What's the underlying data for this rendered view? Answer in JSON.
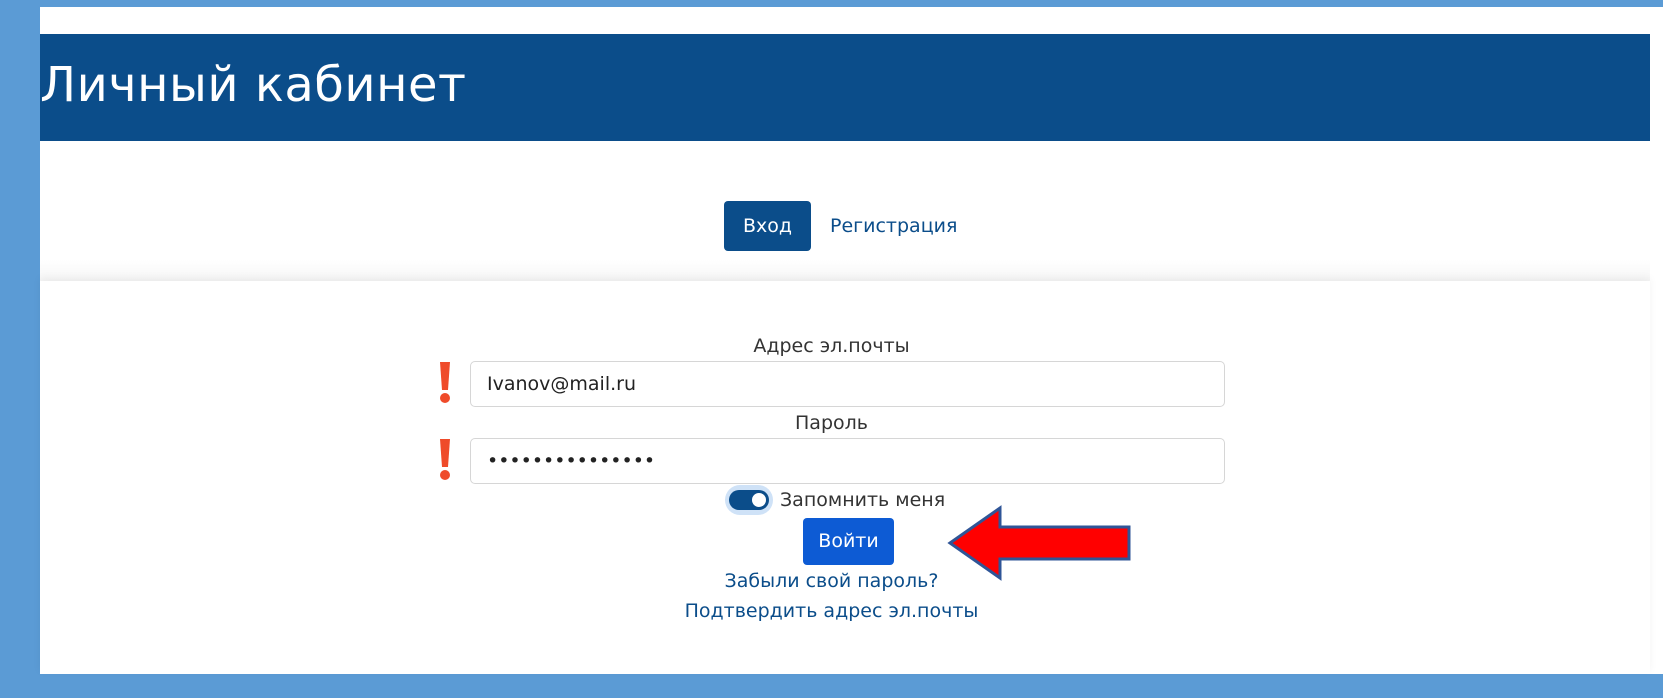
{
  "header": {
    "title": "Личный кабинет"
  },
  "tabs": [
    {
      "label": "Вход",
      "active": true
    },
    {
      "label": "Регистрация",
      "active": false
    }
  ],
  "form": {
    "email_label": "Адрес эл.почты",
    "email_value": "Ivanov@mail.ru",
    "password_label": "Пароль",
    "password_value": "•••••••••••••••",
    "remember_label": "Запомнить меня",
    "remember_checked": true,
    "submit_label": "Войти",
    "forgot_link": "Забыли свой пароль?",
    "confirm_link": "Подтвердить адрес эл.почты"
  },
  "icons": {
    "exclaim": "exclamation-mark-icon",
    "arrow": "left-arrow-icon"
  },
  "colors": {
    "frame": "#5b9bd5",
    "header": "#0b4d8a",
    "primary_button": "#0d5bd4",
    "exclaim": "#ef4b2a",
    "arrow_fill": "#ff0000",
    "arrow_stroke": "#2f5597"
  }
}
